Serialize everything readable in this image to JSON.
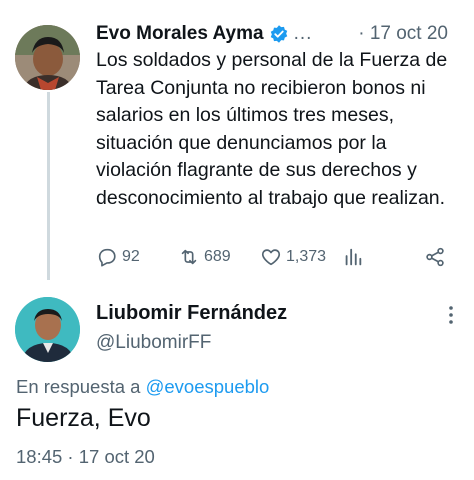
{
  "original_tweet": {
    "author_name": "Evo Morales Ayma",
    "overflow_text": "...",
    "date": "· 17 oct 20",
    "text": "Los soldados y personal de la Fuerza de Tarea Conjunta no recibieron bonos ni salarios en los últimos tres meses, situación que denunciamos por la violación flagrante de sus derechos y desconocimiento al trabajo que realizan.",
    "replies": "92",
    "retweets": "689",
    "likes": "1,373",
    "verified_color": "#1d9bf0"
  },
  "reply_tweet": {
    "author_name": "Liubomir Fernández",
    "handle": "@LiubomirFF",
    "reply_prefix": "En respuesta a",
    "reply_to_handle": "@evoespueblo",
    "text": "Fuerza, Evo",
    "timestamp": "18:45 · 17 oct 20"
  },
  "colors": {
    "accent": "#1d9bf0",
    "secondary_text": "#536471",
    "thread_line": "#cfd9de"
  }
}
